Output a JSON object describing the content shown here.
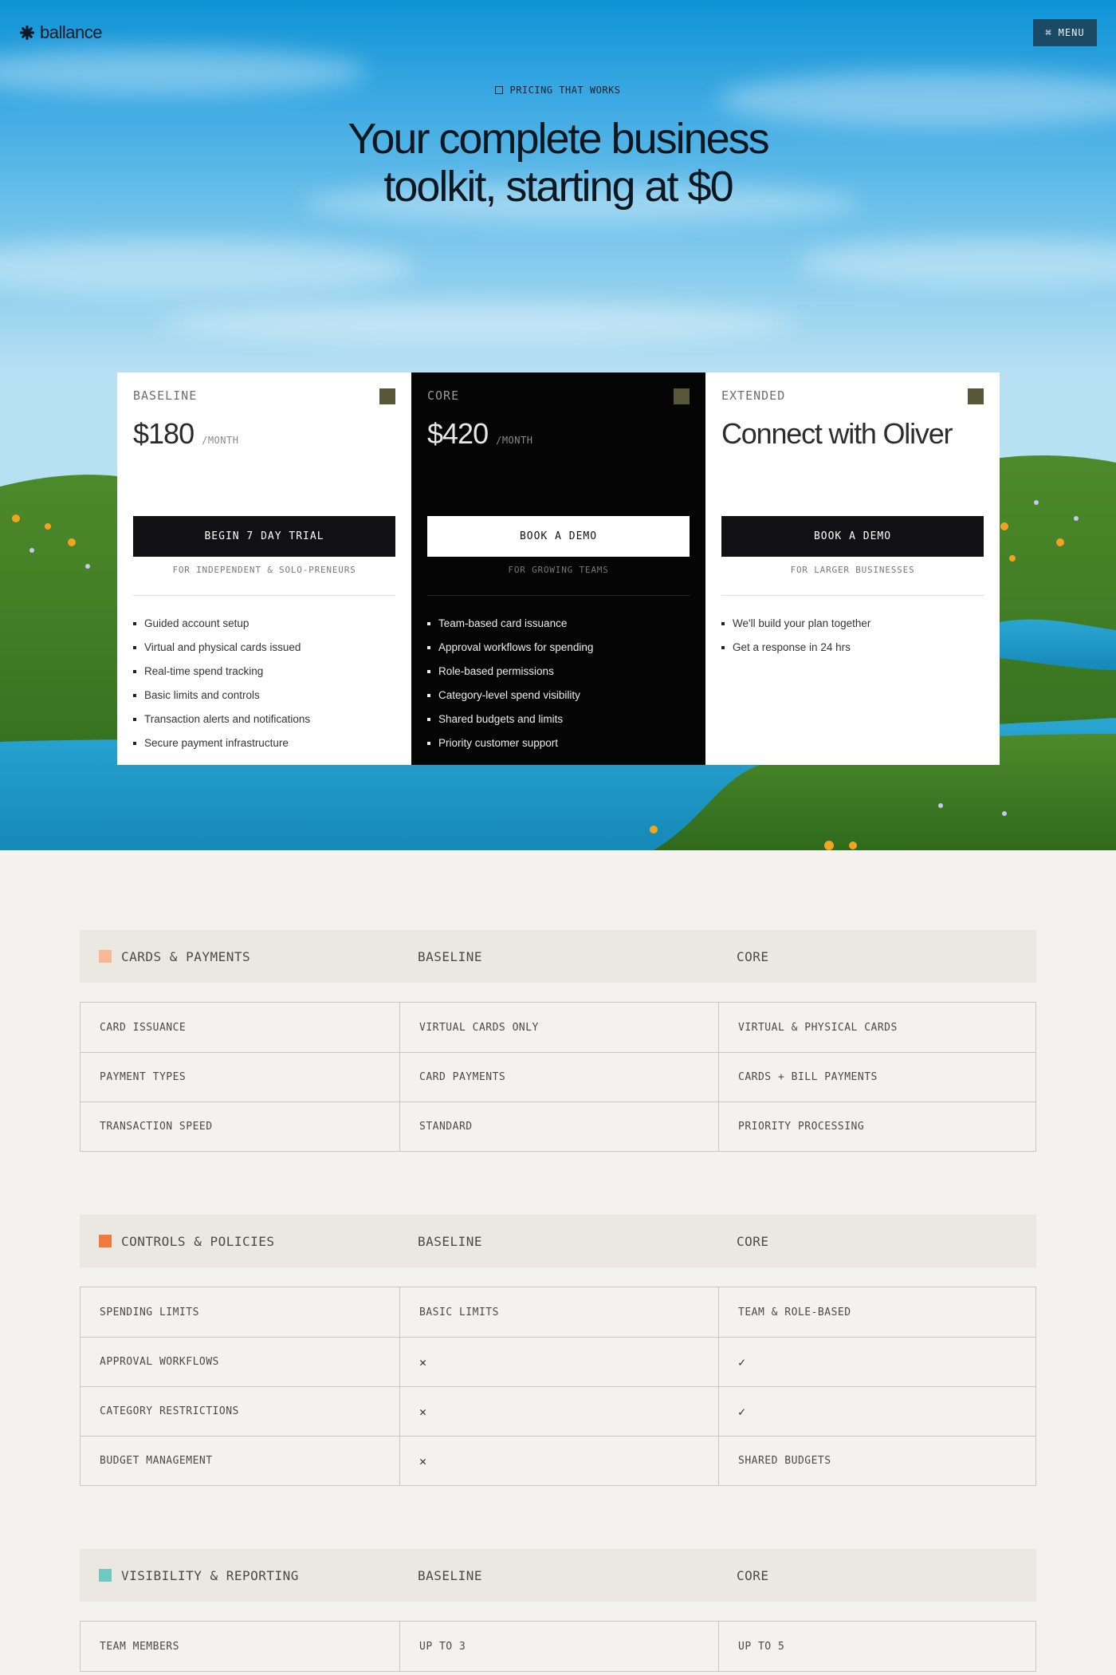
{
  "brand": {
    "name": "ballance",
    "logo_icon": "asterisk-flower-icon"
  },
  "nav": {
    "menu_label": "MENU",
    "menu_icon": "command-icon"
  },
  "hero": {
    "eyebrow": "PRICING THAT WORKS",
    "headline_line1": "Your complete business",
    "headline_line2": "toolkit, starting at $0"
  },
  "plans": [
    {
      "tier": "BASELINE",
      "price": "$180",
      "period": "/MONTH",
      "cta": "BEGIN 7 DAY TRIAL",
      "audience": "FOR INDEPENDENT & SOLO-PRENEURS",
      "features": [
        "Guided account setup",
        "Virtual and physical cards issued",
        "Real-time spend tracking",
        "Basic limits and controls",
        "Transaction alerts and notifications",
        "Secure payment infrastructure"
      ]
    },
    {
      "tier": "CORE",
      "price": "$420",
      "period": "/MONTH",
      "cta": "BOOK A DEMO",
      "audience": "FOR GROWING TEAMS",
      "features": [
        "Team-based card issuance",
        "Approval workflows for spending",
        "Role-based permissions",
        "Category-level spend visibility",
        "Shared budgets and limits",
        "Priority customer support"
      ]
    },
    {
      "tier": "EXTENDED",
      "contact": "Connect with Oliver",
      "cta": "BOOK A DEMO",
      "audience": "FOR LARGER BUSINESSES",
      "features": [
        "We'll build your plan together",
        "Get a response in 24 hrs"
      ]
    }
  ],
  "comparison": [
    {
      "title": "CARDS & PAYMENTS",
      "color": "#f7b995",
      "col2": "BASELINE",
      "col3": "CORE",
      "rows": [
        [
          "CARD ISSUANCE",
          "VIRTUAL CARDS ONLY",
          "VIRTUAL & PHYSICAL CARDS"
        ],
        [
          "PAYMENT TYPES",
          "CARD PAYMENTS",
          "CARDS + BILL PAYMENTS"
        ],
        [
          "TRANSACTION SPEED",
          "STANDARD",
          "PRIORITY PROCESSING"
        ]
      ]
    },
    {
      "title": "CONTROLS & POLICIES",
      "color": "#f07a3c",
      "col2": "BASELINE",
      "col3": "CORE",
      "rows": [
        [
          "SPENDING LIMITS",
          "BASIC LIMITS",
          "TEAM & ROLE-BASED"
        ],
        [
          "APPROVAL WORKFLOWS",
          "✕",
          "✓"
        ],
        [
          "CATEGORY RESTRICTIONS",
          "✕",
          "✓"
        ],
        [
          "BUDGET MANAGEMENT",
          "✕",
          "SHARED BUDGETS"
        ]
      ]
    },
    {
      "title": "VISIBILITY & REPORTING",
      "color": "#6ec9c4",
      "col2": "BASELINE",
      "col3": "CORE",
      "rows": [
        [
          "TEAM MEMBERS",
          "UP TO 3",
          "UP TO 5"
        ]
      ]
    }
  ]
}
